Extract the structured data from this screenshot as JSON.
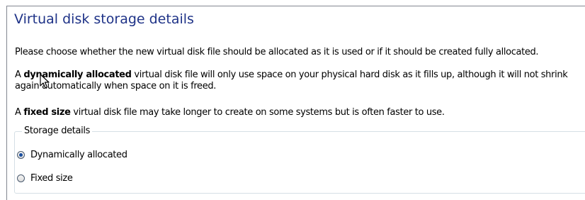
{
  "page": {
    "title": "Virtual disk storage details"
  },
  "paragraphs": {
    "intro": "Please choose whether the new virtual disk file should be allocated as it is used or if it should be created fully allocated.",
    "dynamic_prefix": "A ",
    "dynamic_bold": "dynamically allocated",
    "dynamic_rest": " virtual disk file will only use space on your physical hard disk as it fills up, although it will not shrink again automatically when space on it is freed.",
    "fixed_prefix": "A ",
    "fixed_bold": "fixed size",
    "fixed_rest": " virtual disk file may take longer to create on some systems but is often faster to use."
  },
  "storage": {
    "legend": "Storage details",
    "options": [
      {
        "label": "Dynamically allocated",
        "selected": true
      },
      {
        "label": "Fixed size",
        "selected": false
      }
    ]
  },
  "colors": {
    "title": "#1e3287",
    "radio_dot": "#1a4fa0"
  },
  "icons": {
    "cursor": "arrow-cursor-icon"
  }
}
